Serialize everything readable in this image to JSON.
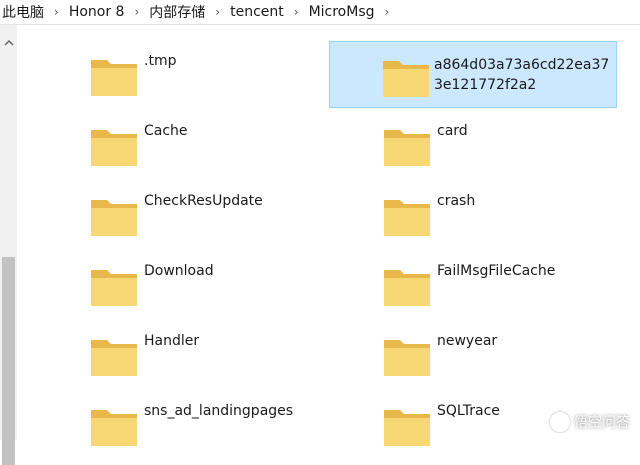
{
  "breadcrumb": [
    "此电脑",
    "Honor 8",
    "内部存储",
    "tencent",
    "MicroMsg"
  ],
  "folders": [
    {
      "name": ".tmp",
      "selected": false
    },
    {
      "name": "a864d03a73a6cd22ea373e121772f2a2",
      "selected": true
    },
    {
      "name": "Cache",
      "selected": false
    },
    {
      "name": "card",
      "selected": false
    },
    {
      "name": "CheckResUpdate",
      "selected": false
    },
    {
      "name": "crash",
      "selected": false
    },
    {
      "name": "Download",
      "selected": false
    },
    {
      "name": "FailMsgFileCache",
      "selected": false
    },
    {
      "name": "Handler",
      "selected": false
    },
    {
      "name": "newyear",
      "selected": false
    },
    {
      "name": "sns_ad_landingpages",
      "selected": false
    },
    {
      "name": "SQLTrace",
      "selected": false
    }
  ],
  "watermark": {
    "text": "悟空问答"
  },
  "colors": {
    "selection": "#cce8ff",
    "selection_border": "#99d1ff",
    "folder": "#f8d775",
    "folder_dark": "#e8b84a"
  }
}
